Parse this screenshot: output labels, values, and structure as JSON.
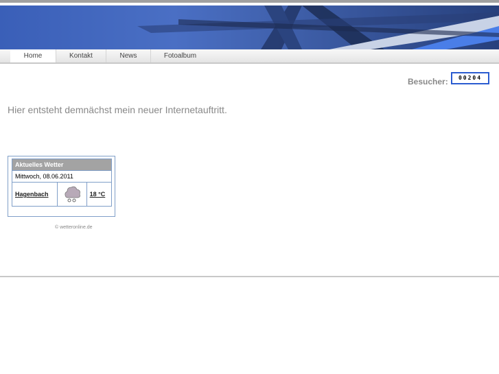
{
  "nav": {
    "items": [
      {
        "label": "Home"
      },
      {
        "label": "Kontakt"
      },
      {
        "label": "News"
      },
      {
        "label": "Fotoalbum"
      }
    ]
  },
  "visitors": {
    "label": "Besucher:",
    "count": "00204"
  },
  "intro": "Hier entsteht demnächst mein neuer Internetauftritt.",
  "weather": {
    "title": "Aktuelles Wetter",
    "date": "Mittwoch, 08.06.2011",
    "location": "Hagenbach",
    "icon": "cloud-rain-icon",
    "temperature": "18 °C",
    "credit": "© wetteronline.de"
  }
}
